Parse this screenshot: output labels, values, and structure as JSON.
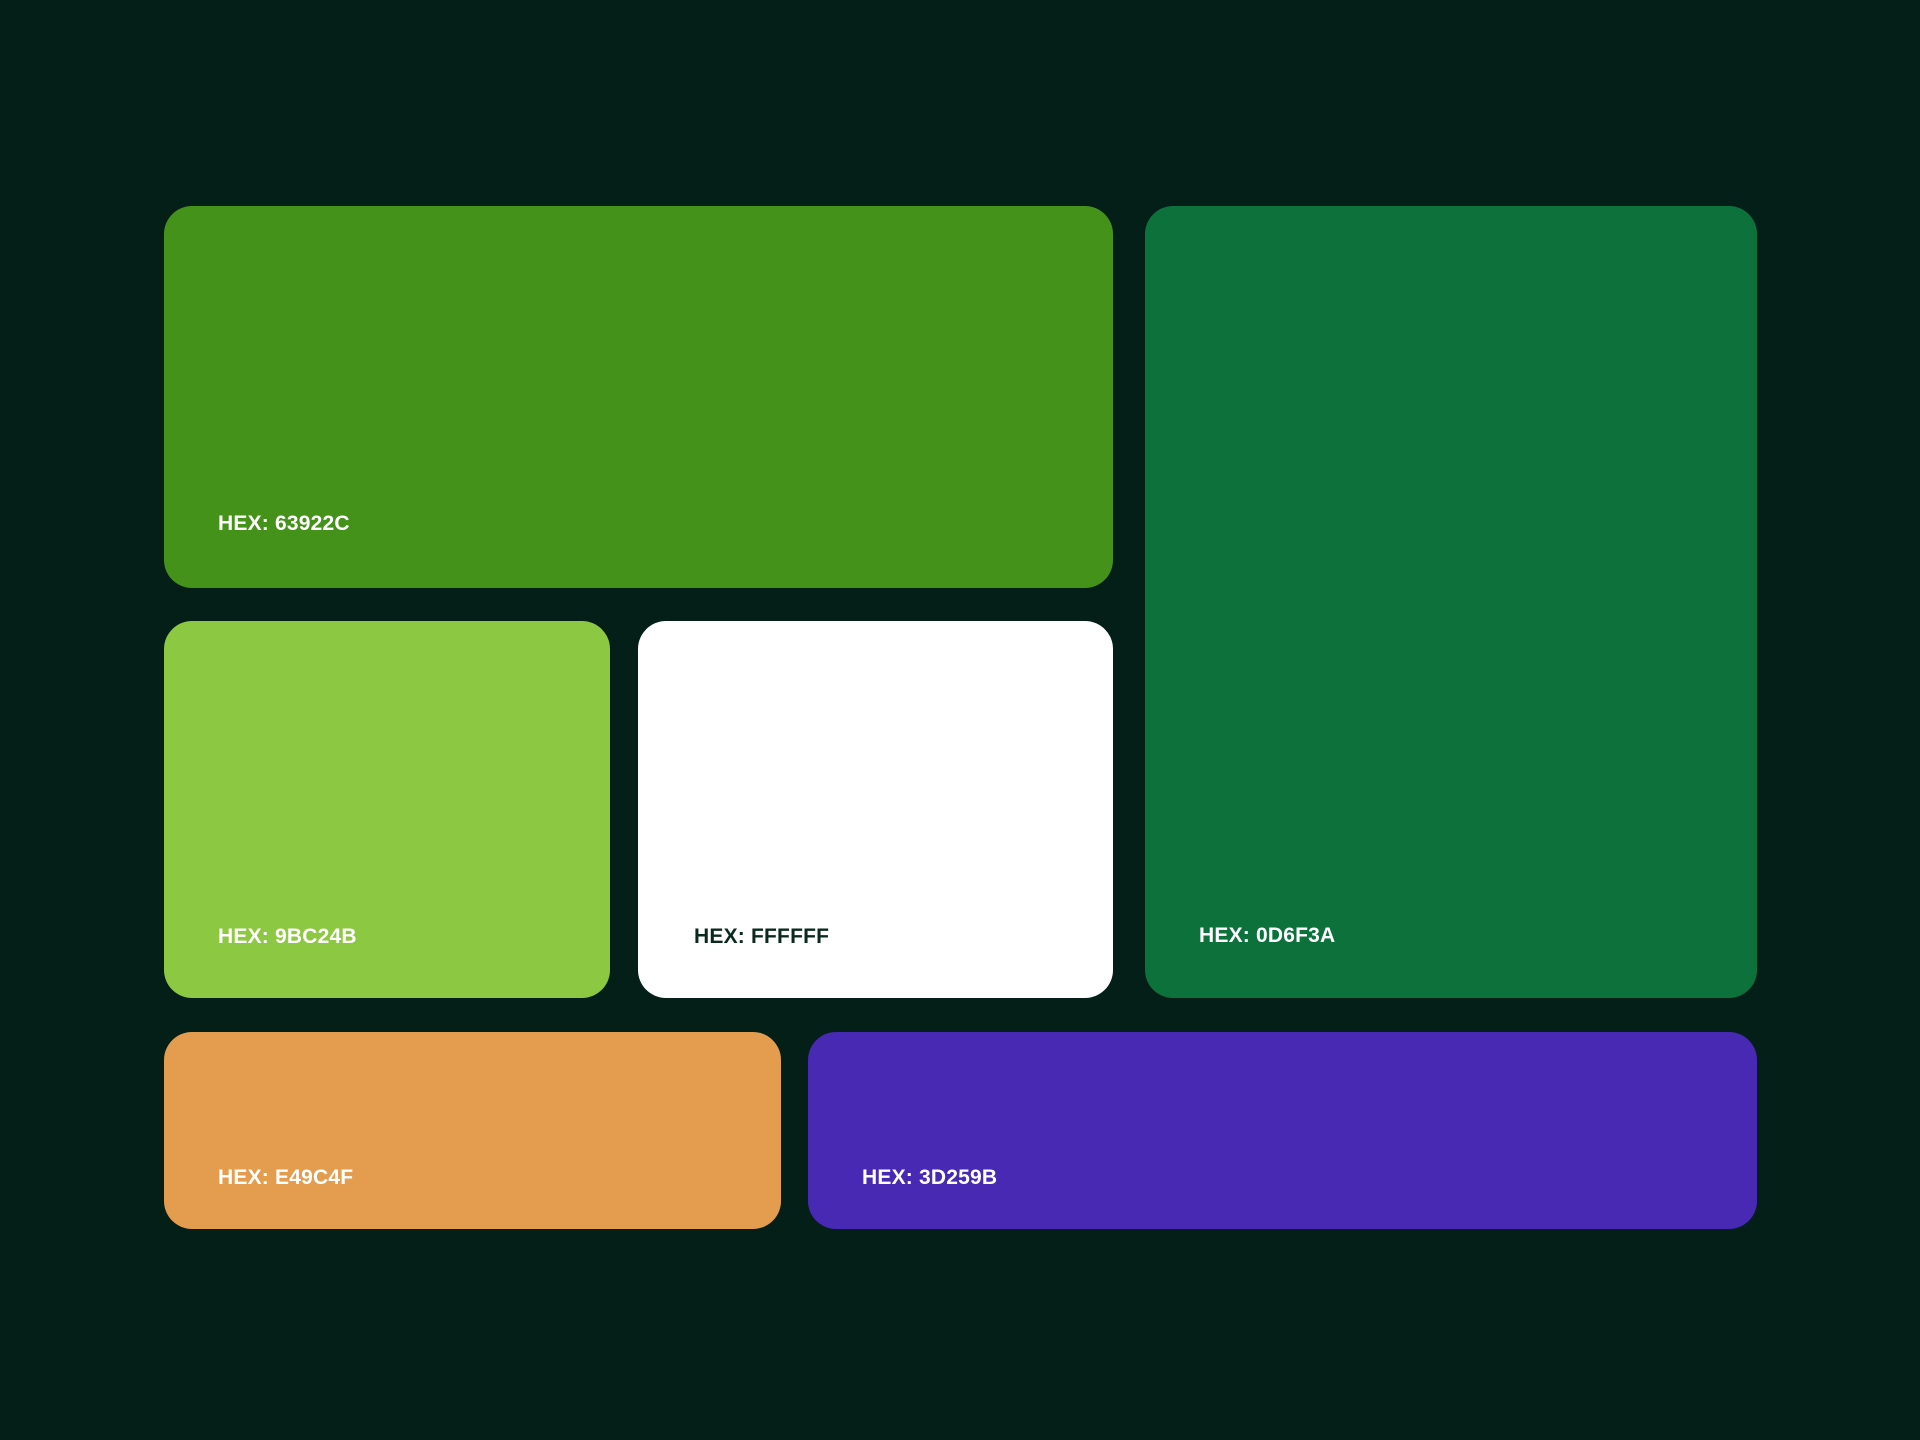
{
  "background_color": "#041f18",
  "swatches": [
    {
      "label": "HEX: 63922C",
      "fill": "#45921a",
      "text_color": "#ffffff"
    },
    {
      "label": "HEX: 0D6F3A",
      "fill": "#0d713c",
      "text_color": "#ffffff"
    },
    {
      "label": "HEX: 9BC24B",
      "fill": "#8cc841",
      "text_color": "#ffffff"
    },
    {
      "label": "HEX: FFFFFF",
      "fill": "#ffffff",
      "text_color": "#0b2a1e"
    },
    {
      "label": "HEX: E49C4F",
      "fill": "#e49c4f",
      "text_color": "#ffffff"
    },
    {
      "label": "HEX: 3D259B",
      "fill": "#4729b4",
      "text_color": "#ffffff"
    }
  ]
}
